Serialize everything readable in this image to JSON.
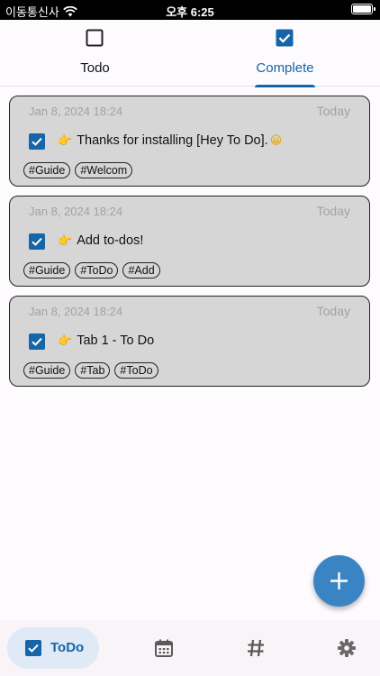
{
  "status_bar": {
    "carrier": "이동통신사",
    "time": "오후 6:25"
  },
  "top_tabs": [
    {
      "label": "Todo",
      "selected": false
    },
    {
      "label": "Complete",
      "selected": true
    }
  ],
  "todos": [
    {
      "date": "Jan 8, 2024 18:24",
      "day": "Today",
      "title": "Thanks for installing [Hey To Do].",
      "tags": [
        "#Guide",
        "#Welcom"
      ],
      "checked": true
    },
    {
      "date": "Jan 8, 2024 18:24",
      "day": "Today",
      "title": "Add to-dos!",
      "tags": [
        "#Guide",
        "#ToDo",
        "#Add"
      ],
      "checked": true
    },
    {
      "date": "Jan 8, 2024 18:24",
      "day": "Today",
      "title": "Tab 1 - To Do",
      "tags": [
        "#Guide",
        "#Tab",
        "#ToDo"
      ],
      "checked": true
    }
  ],
  "fab": {
    "icon": "plus-icon"
  },
  "bottom_nav": {
    "active_label": "ToDo",
    "items": [
      "checkbox-icon",
      "calendar-icon",
      "hashtag-icon",
      "gear-icon"
    ]
  },
  "colors": {
    "accent": "#1565a8",
    "fab": "#3b84c4",
    "card_bg": "#d6d6d6",
    "muted_text": "#a2a2a2"
  }
}
